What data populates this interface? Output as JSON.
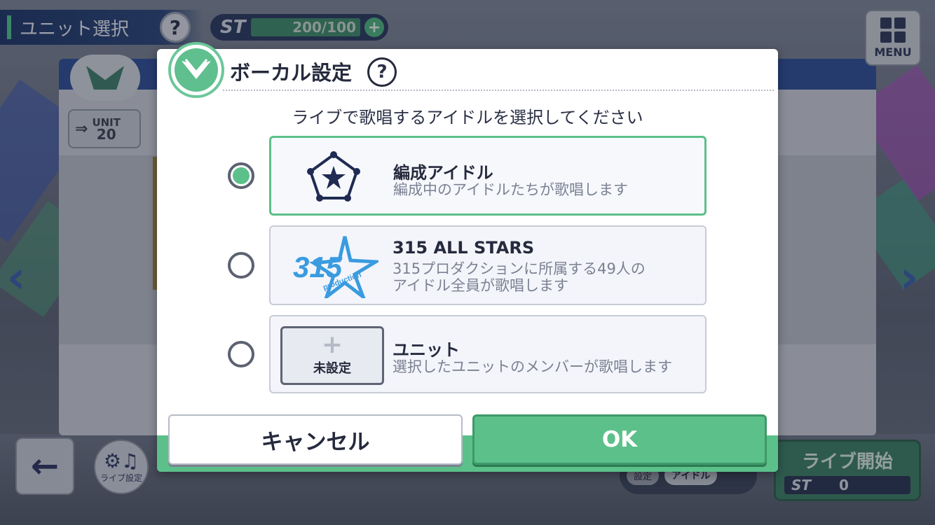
{
  "header": {
    "title": "ユニット選択",
    "help": "?",
    "stamina": {
      "label": "ST",
      "value": "200/100",
      "plus": "+"
    },
    "menu_label": "MENU"
  },
  "unit_badge": {
    "label": "UNIT",
    "number": "20"
  },
  "bottom": {
    "live_setting_label": "ライブ設定",
    "vocal_setting_tag": "設定",
    "vocal_setting_value": "アイドル",
    "start_label": "ライブ開始",
    "start_cost_label": "ST",
    "start_cost_value": "0"
  },
  "dialog": {
    "title": "ボーカル設定",
    "help": "?",
    "instruction": "ライブで歌唱するアイドルを選択してください",
    "options": [
      {
        "title": "編成アイドル",
        "desc": "編成中のアイドルたちが歌唱します",
        "selected": true,
        "icon": "pentagon-star-icon"
      },
      {
        "title": "315 ALL STARS",
        "desc_line1": "315プロダクションに所属する49人の",
        "desc_line2": "アイドル全員が歌唱します",
        "selected": false,
        "icon": "315-production-logo"
      },
      {
        "title": "ユニット",
        "desc": "選択したユニットのメンバーが歌唱します",
        "selected": false,
        "unset_label": "未設定",
        "unset_plus": "+"
      }
    ],
    "cancel_label": "キャンセル",
    "ok_label": "OK"
  },
  "colors": {
    "accent_green": "#5cc08a",
    "dark_text": "#262a3d",
    "navy": "#2a3a5e"
  }
}
